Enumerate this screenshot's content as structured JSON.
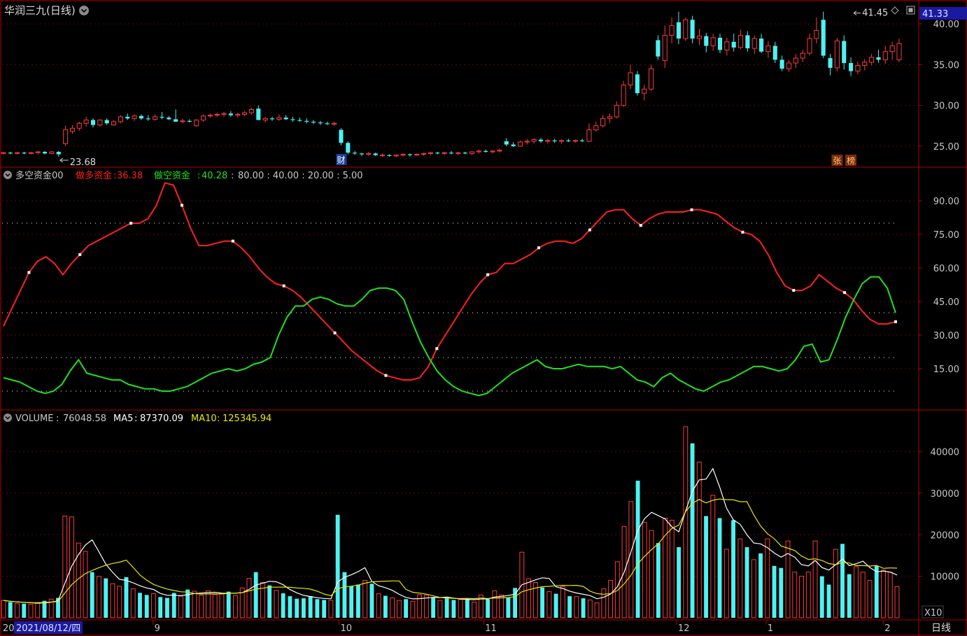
{
  "colors": {
    "up": "#ff3b3b",
    "down": "#4ef2f2",
    "long": "#ff2020",
    "short": "#20e020",
    "ma5": "#ffffff",
    "ma10": "#e8e800",
    "axis": "#b00000",
    "grid": "#6a0000",
    "text": "#c8c8c8",
    "blue": "#1a1aa0"
  },
  "header": {
    "title": "华润三九(日线)",
    "settings_icon": "circle-chevron-down-icon",
    "top_icons": [
      "diamond-icon",
      "square-icon"
    ]
  },
  "price_panel": {
    "current_price": "41.33",
    "high_label": "41.45",
    "low_label": "23.68",
    "markers": {
      "cai": "财",
      "zhang": "张",
      "bang": "榜"
    },
    "yticks": [
      "40.00",
      "35.00",
      "30.00",
      "25.00"
    ]
  },
  "indicator_panel": {
    "name": "多空资金00",
    "long_name": "做多资金",
    "long_value": "36.38",
    "short_name": "做空资金",
    "short_value": "40.28",
    "levels": "80.00 : 40.00 : 20.00 : 5.00",
    "yticks": [
      "90.00",
      "75.00",
      "60.00",
      "45.00",
      "30.00",
      "15.00"
    ]
  },
  "volume_panel": {
    "name": "VOLUME",
    "value": "76048.58",
    "ma5_name": "MA5",
    "ma5_value": "87370.09",
    "ma10_name": "MA10",
    "ma10_value": "125345.94",
    "yticks": [
      "40000",
      "30000",
      "20000",
      "10000"
    ],
    "multiplier": "X10"
  },
  "xaxis": {
    "first": "20",
    "date_box": "2021/08/12/四",
    "months": [
      "9",
      "10",
      "11",
      "12",
      "1",
      "2"
    ],
    "period_button": "日线"
  },
  "chart_data": [
    {
      "type": "candlestick",
      "title": "华润三九(日线)",
      "ylim": [
        22.5,
        42.5
      ],
      "candles": [
        [
          24.1,
          24.3,
          24.0,
          24.2
        ],
        [
          24.2,
          24.3,
          24.0,
          24.1
        ],
        [
          24.1,
          24.3,
          24.0,
          24.2
        ],
        [
          24.2,
          24.3,
          24.0,
          24.1
        ],
        [
          24.1,
          24.3,
          24.0,
          24.2
        ],
        [
          24.2,
          24.4,
          24.0,
          24.3
        ],
        [
          24.3,
          24.4,
          24.0,
          24.1
        ],
        [
          24.1,
          24.4,
          24.0,
          24.3
        ],
        [
          24.3,
          24.4,
          23.7,
          24.0
        ],
        [
          25.3,
          27.5,
          25.0,
          27.0
        ],
        [
          26.8,
          27.6,
          26.5,
          27.2
        ],
        [
          27.2,
          28.0,
          26.9,
          27.8
        ],
        [
          27.8,
          28.6,
          27.4,
          28.2
        ],
        [
          28.2,
          28.4,
          27.3,
          27.6
        ],
        [
          27.6,
          28.3,
          27.4,
          28.2
        ],
        [
          28.2,
          28.4,
          27.6,
          27.8
        ],
        [
          27.6,
          28.2,
          27.5,
          28.0
        ],
        [
          28.0,
          28.8,
          27.8,
          28.6
        ],
        [
          28.6,
          29.0,
          28.2,
          28.4
        ],
        [
          28.4,
          28.9,
          28.1,
          28.7
        ],
        [
          28.7,
          28.9,
          28.2,
          28.4
        ],
        [
          28.4,
          28.8,
          28.1,
          28.3
        ],
        [
          28.3,
          28.9,
          28.1,
          28.6
        ],
        [
          28.6,
          29.2,
          28.3,
          28.5
        ],
        [
          28.5,
          28.7,
          28.2,
          28.3
        ],
        [
          28.3,
          29.5,
          28.2,
          28.0
        ],
        [
          28.0,
          28.4,
          27.8,
          28.1
        ],
        [
          28.1,
          28.3,
          27.9,
          28.0
        ],
        [
          27.5,
          28.3,
          27.4,
          28.2
        ],
        [
          28.2,
          28.9,
          28.0,
          28.7
        ],
        [
          28.7,
          29.0,
          28.5,
          28.8
        ],
        [
          28.8,
          29.1,
          28.6,
          28.9
        ],
        [
          28.9,
          29.2,
          28.6,
          29.0
        ],
        [
          29.0,
          29.3,
          28.6,
          28.8
        ],
        [
          28.8,
          29.1,
          28.5,
          28.9
        ],
        [
          28.9,
          29.3,
          28.7,
          29.1
        ],
        [
          29.1,
          29.7,
          28.9,
          29.5
        ],
        [
          29.6,
          30.0,
          28.5,
          28.2
        ],
        [
          28.2,
          28.6,
          27.9,
          28.4
        ],
        [
          28.4,
          28.6,
          28.1,
          28.3
        ],
        [
          28.3,
          28.9,
          28.1,
          28.5
        ],
        [
          28.5,
          28.8,
          28.2,
          28.3
        ],
        [
          28.3,
          28.6,
          28.0,
          28.2
        ],
        [
          28.2,
          28.5,
          28.0,
          28.1
        ],
        [
          28.1,
          28.4,
          27.8,
          28.0
        ],
        [
          28.0,
          28.2,
          27.7,
          27.9
        ],
        [
          27.9,
          28.1,
          27.6,
          27.8
        ],
        [
          27.8,
          28.0,
          27.6,
          27.7
        ],
        [
          27.7,
          28.0,
          27.5,
          27.8
        ],
        [
          27.0,
          27.2,
          25.1,
          25.4
        ],
        [
          25.4,
          25.6,
          24.0,
          24.2
        ],
        [
          24.2,
          24.4,
          23.9,
          24.1
        ],
        [
          24.1,
          24.2,
          23.8,
          24.0
        ],
        [
          24.0,
          24.3,
          23.8,
          24.1
        ],
        [
          24.1,
          24.2,
          23.8,
          23.9
        ],
        [
          23.9,
          24.1,
          23.7,
          23.9
        ],
        [
          23.9,
          24.0,
          23.7,
          23.8
        ],
        [
          23.8,
          24.0,
          23.6,
          23.9
        ],
        [
          23.9,
          24.1,
          23.7,
          24.0
        ],
        [
          24.0,
          24.1,
          23.7,
          23.9
        ],
        [
          23.9,
          24.1,
          23.8,
          24.0
        ],
        [
          24.0,
          24.2,
          23.8,
          24.1
        ],
        [
          24.1,
          24.3,
          23.9,
          24.2
        ],
        [
          24.2,
          24.3,
          24.0,
          24.1
        ],
        [
          24.1,
          24.3,
          23.9,
          24.2
        ],
        [
          24.2,
          24.4,
          24.0,
          24.1
        ],
        [
          24.1,
          24.3,
          23.9,
          24.2
        ],
        [
          24.2,
          24.3,
          24.0,
          24.1
        ],
        [
          24.1,
          24.4,
          23.9,
          24.3
        ],
        [
          24.3,
          24.6,
          24.1,
          24.4
        ],
        [
          24.4,
          24.6,
          24.2,
          24.3
        ],
        [
          24.3,
          24.5,
          24.1,
          24.4
        ],
        [
          24.4,
          24.7,
          24.2,
          24.5
        ],
        [
          25.6,
          26.0,
          25.0,
          25.2
        ],
        [
          25.2,
          25.5,
          24.9,
          25.0
        ],
        [
          25.0,
          25.7,
          24.9,
          25.5
        ],
        [
          25.5,
          25.9,
          25.2,
          25.6
        ],
        [
          25.6,
          26.0,
          25.3,
          25.8
        ],
        [
          25.8,
          26.0,
          25.4,
          25.6
        ],
        [
          25.6,
          25.9,
          25.3,
          25.7
        ],
        [
          25.7,
          25.9,
          25.4,
          25.6
        ],
        [
          25.6,
          25.8,
          25.3,
          25.7
        ],
        [
          25.7,
          25.9,
          25.5,
          25.6
        ],
        [
          25.6,
          25.8,
          25.4,
          25.7
        ],
        [
          25.7,
          25.9,
          25.5,
          25.6
        ],
        [
          25.6,
          27.8,
          25.5,
          27.0
        ],
        [
          27.0,
          28.0,
          26.8,
          27.5
        ],
        [
          27.5,
          28.8,
          27.3,
          28.4
        ],
        [
          28.4,
          29.0,
          27.8,
          28.6
        ],
        [
          28.6,
          30.5,
          28.4,
          30.0
        ],
        [
          30.0,
          33.0,
          29.8,
          32.5
        ],
        [
          32.5,
          35.0,
          32.0,
          34.0
        ],
        [
          33.8,
          34.2,
          31.2,
          31.5
        ],
        [
          31.5,
          32.5,
          30.6,
          32.0
        ],
        [
          32.0,
          35.0,
          31.8,
          34.5
        ],
        [
          38.0,
          38.6,
          35.6,
          36.0
        ],
        [
          35.5,
          39.8,
          34.6,
          38.6
        ],
        [
          38.6,
          40.8,
          37.6,
          39.8
        ],
        [
          40.2,
          41.5,
          37.5,
          38.2
        ],
        [
          38.2,
          40.8,
          37.9,
          40.5
        ],
        [
          40.5,
          41.0,
          37.6,
          38.2
        ],
        [
          38.2,
          39.4,
          37.4,
          38.5
        ],
        [
          38.5,
          38.9,
          36.5,
          37.3
        ],
        [
          37.3,
          38.8,
          36.7,
          38.3
        ],
        [
          38.3,
          38.8,
          36.4,
          36.8
        ],
        [
          36.8,
          38.3,
          36.1,
          37.8
        ],
        [
          37.8,
          38.8,
          36.6,
          37.1
        ],
        [
          37.1,
          39.3,
          36.9,
          38.6
        ],
        [
          38.6,
          39.1,
          36.6,
          37.0
        ],
        [
          37.0,
          38.6,
          36.3,
          38.2
        ],
        [
          38.2,
          38.8,
          36.4,
          36.6
        ],
        [
          36.6,
          37.9,
          35.8,
          37.3
        ],
        [
          37.3,
          37.8,
          35.2,
          35.6
        ],
        [
          35.6,
          36.1,
          34.2,
          34.5
        ],
        [
          34.5,
          35.6,
          34.1,
          35.2
        ],
        [
          35.2,
          36.3,
          34.6,
          35.8
        ],
        [
          35.8,
          36.8,
          35.3,
          36.4
        ],
        [
          36.4,
          38.8,
          36.1,
          38.2
        ],
        [
          38.2,
          40.8,
          37.6,
          39.2
        ],
        [
          40.5,
          41.5,
          35.8,
          36.1
        ],
        [
          35.8,
          36.3,
          33.7,
          34.6
        ],
        [
          34.6,
          38.3,
          34.2,
          37.9
        ],
        [
          37.9,
          38.6,
          34.4,
          35.2
        ],
        [
          35.2,
          35.9,
          33.6,
          34.2
        ],
        [
          34.2,
          35.4,
          33.8,
          34.9
        ],
        [
          34.9,
          35.7,
          34.3,
          35.3
        ],
        [
          35.3,
          36.3,
          34.9,
          35.9
        ],
        [
          35.9,
          36.8,
          35.2,
          35.6
        ],
        [
          35.6,
          37.3,
          35.1,
          36.6
        ],
        [
          36.6,
          37.8,
          35.6,
          37.3
        ],
        [
          35.6,
          38.2,
          35.3,
          37.6
        ]
      ]
    },
    {
      "type": "line",
      "title": "多空资金00",
      "ylim": [
        0,
        100
      ],
      "levels": [
        80,
        40,
        20,
        5
      ],
      "series": [
        {
          "name": "做多资金",
          "color": "#ff2020",
          "values": [
            34,
            42,
            50,
            58,
            63,
            65,
            62,
            57,
            62,
            66,
            70,
            72,
            74,
            76,
            78,
            80,
            80,
            82,
            88,
            98,
            97,
            88,
            78,
            70,
            70,
            71,
            72,
            72,
            69,
            65,
            60,
            56,
            53,
            52,
            50,
            47,
            43,
            39,
            35,
            31,
            27,
            23,
            20,
            17,
            14,
            12,
            11,
            10,
            10,
            11,
            16,
            24,
            30,
            36,
            42,
            48,
            53,
            57,
            58,
            62,
            62,
            64,
            66,
            69,
            71,
            72,
            72,
            71,
            73,
            77,
            81,
            85,
            86,
            86,
            82,
            79,
            82,
            84,
            85,
            85,
            85,
            86,
            86,
            85,
            84,
            81,
            78,
            76,
            75,
            72,
            66,
            58,
            52,
            50,
            50,
            52,
            57,
            54,
            51,
            49,
            46,
            41,
            37,
            35,
            35,
            36
          ]
        },
        {
          "name": "做空资金",
          "color": "#20e020",
          "values": [
            11,
            10,
            9,
            7,
            5,
            4,
            5,
            8,
            14,
            19,
            13,
            12,
            11,
            10,
            10,
            8,
            7,
            6,
            6,
            5,
            5,
            6,
            7,
            9,
            11,
            13,
            14,
            15,
            14,
            15,
            17,
            18,
            20,
            30,
            38,
            43,
            43,
            46,
            47,
            46,
            44,
            43,
            43,
            46,
            50,
            51,
            51,
            50,
            46,
            36,
            27,
            20,
            14,
            10,
            7,
            5,
            4,
            3,
            4,
            7,
            10,
            13,
            15,
            17,
            19,
            16,
            15,
            15,
            16,
            17,
            16,
            16,
            16,
            15,
            16,
            13,
            10,
            9,
            7,
            11,
            13,
            10,
            8,
            6,
            5,
            7,
            9,
            10,
            12,
            14,
            16,
            16,
            15,
            14,
            15,
            19,
            25,
            26,
            18,
            19,
            28,
            38,
            46,
            53,
            56,
            56,
            51,
            40
          ]
        }
      ]
    },
    {
      "type": "bar",
      "title": "VOLUME",
      "ylim": [
        0,
        48000
      ],
      "multiplier": "X10",
      "values": [
        4200,
        3800,
        3500,
        3400,
        3300,
        3600,
        4100,
        4500,
        4800,
        24500,
        24300,
        18000,
        16000,
        11000,
        10000,
        9500,
        8200,
        7600,
        9800,
        7000,
        6000,
        5500,
        5800,
        5000,
        4800,
        6000,
        5200,
        6800,
        6400,
        5400,
        6500,
        5600,
        5800,
        6300,
        5400,
        7200,
        9500,
        11000,
        8500,
        7800,
        6600,
        5900,
        5200,
        4600,
        4700,
        5200,
        4500,
        4300,
        4200,
        24800,
        11000,
        7600,
        8000,
        9000,
        8200,
        5800,
        5300,
        4800,
        4200,
        4500,
        4000,
        5600,
        5500,
        5000,
        4200,
        4700,
        4300,
        4400,
        4600,
        3800,
        5500,
        4500,
        6500,
        5500,
        4800,
        7200,
        15800,
        9400,
        8500,
        7300,
        6300,
        5800,
        7500,
        5200,
        5100,
        4700,
        4300,
        3600,
        7000,
        9000,
        13500,
        22000,
        28000,
        33000,
        23000,
        21000,
        18000,
        24000,
        23500,
        17000,
        46000,
        42000,
        37500,
        24500,
        29500,
        24000,
        16500,
        23500,
        19000,
        17000,
        14000,
        15500,
        19000,
        12500,
        12000,
        18500,
        11000,
        10000,
        11000,
        18500,
        10000,
        8000,
        16500,
        17800,
        10500,
        12300,
        11000,
        9000,
        12500,
        11500,
        11000,
        7500
      ]
    }
  ]
}
